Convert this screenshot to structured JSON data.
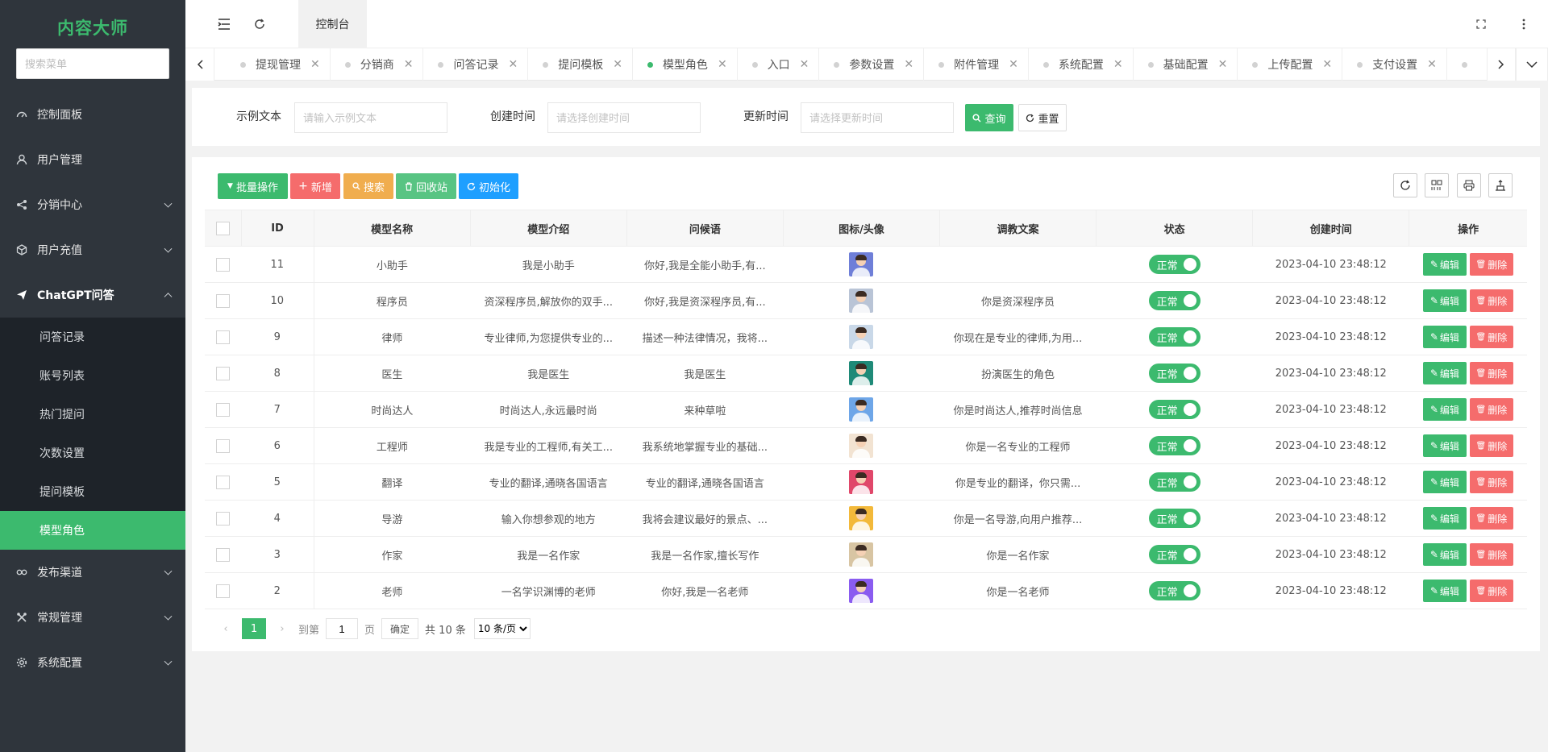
{
  "app": {
    "title": "内容大师",
    "search_placeholder": "搜索菜单"
  },
  "menu": [
    {
      "label": "控制面板",
      "icon": "dashboard-icon"
    },
    {
      "label": "用户管理",
      "icon": "user-icon"
    },
    {
      "label": "分销中心",
      "icon": "share-icon"
    },
    {
      "label": "用户充值",
      "icon": "box-icon"
    },
    {
      "label": "ChatGPT问答",
      "icon": "send-icon"
    }
  ],
  "submenu": [
    "问答记录",
    "账号列表",
    "热门提问",
    "次数设置",
    "提问模板",
    "模型角色"
  ],
  "menu_after": [
    {
      "label": "发布渠道",
      "icon": "link-icon"
    },
    {
      "label": "常规管理",
      "icon": "tools-icon"
    },
    {
      "label": "系统配置",
      "icon": "gear-icon"
    }
  ],
  "topbar": {
    "tab": "控制台"
  },
  "tabs": [
    "提现管理",
    "分销商",
    "问答记录",
    "提问模板",
    "模型角色",
    "入口",
    "参数设置",
    "附件管理",
    "系统配置",
    "基础配置",
    "上传配置",
    "支付设置",
    ""
  ],
  "active_tab": "模型角色",
  "filter": {
    "f1_label": "示例文本",
    "f1_placeholder": "请输入示例文本",
    "f2_label": "创建时间",
    "f2_placeholder": "请选择创建时间",
    "f3_label": "更新时间",
    "f3_placeholder": "请选择更新时间",
    "query": "查询",
    "reset": "重置"
  },
  "toolbar": {
    "batch": "批量操作",
    "add": "新增",
    "search": "搜索",
    "recycle": "回收站",
    "init": "初始化"
  },
  "columns": [
    "ID",
    "模型名称",
    "模型介绍",
    "问候语",
    "图标/头像",
    "调教文案",
    "状态",
    "创建时间",
    "操作"
  ],
  "rows": [
    {
      "id": "11",
      "name": "小助手",
      "intro": "我是小助手",
      "greet": "你好,我是全能小助手,有...",
      "prompt": "",
      "status": "正常",
      "time": "2023-04-10 23:48:12",
      "avatar": "#6f7fd8"
    },
    {
      "id": "10",
      "name": "程序员",
      "intro": "资深程序员,解放你的双手...",
      "greet": "你好,我是资深程序员,有...",
      "prompt": "你是资深程序员",
      "status": "正常",
      "time": "2023-04-10 23:48:12",
      "avatar": "#b9c4d6"
    },
    {
      "id": "9",
      "name": "律师",
      "intro": "专业律师,为您提供专业的...",
      "greet": "描述一种法律情况，我将...",
      "prompt": "你现在是专业的律师,为用...",
      "status": "正常",
      "time": "2023-04-10 23:48:12",
      "avatar": "#c9d8e8"
    },
    {
      "id": "8",
      "name": "医生",
      "intro": "我是医生",
      "greet": "我是医生",
      "prompt": "扮演医生的角色",
      "status": "正常",
      "time": "2023-04-10 23:48:12",
      "avatar": "#1f8a78"
    },
    {
      "id": "7",
      "name": "时尚达人",
      "intro": "时尚达人,永远最时尚",
      "greet": "来种草啦",
      "prompt": "你是时尚达人,推荐时尚信息",
      "status": "正常",
      "time": "2023-04-10 23:48:12",
      "avatar": "#6ea6e8"
    },
    {
      "id": "6",
      "name": "工程师",
      "intro": "我是专业的工程师,有关工...",
      "greet": "我系统地掌握专业的基础...",
      "prompt": "你是一名专业的工程师",
      "status": "正常",
      "time": "2023-04-10 23:48:12",
      "avatar": "#f2e3d2"
    },
    {
      "id": "5",
      "name": "翻译",
      "intro": "专业的翻译,通晓各国语言",
      "greet": "专业的翻译,通晓各国语言",
      "prompt": "你是专业的翻译，你只需...",
      "status": "正常",
      "time": "2023-04-10 23:48:12",
      "avatar": "#e0476a"
    },
    {
      "id": "4",
      "name": "导游",
      "intro": "输入你想参观的地方",
      "greet": "我将会建议最好的景点、...",
      "prompt": "你是一名导游,向用户推荐...",
      "status": "正常",
      "time": "2023-04-10 23:48:12",
      "avatar": "#f3b93a"
    },
    {
      "id": "3",
      "name": "作家",
      "intro": "我是一名作家",
      "greet": "我是一名作家,擅长写作",
      "prompt": "你是一名作家",
      "status": "正常",
      "time": "2023-04-10 23:48:12",
      "avatar": "#d8c5a3"
    },
    {
      "id": "2",
      "name": "老师",
      "intro": "一名学识渊博的老师",
      "greet": "你好,我是一名老师",
      "prompt": "你是一名老师",
      "status": "正常",
      "time": "2023-04-10 23:48:12",
      "avatar": "#8a5cf0"
    }
  ],
  "row_actions": {
    "edit": "编辑",
    "del": "删除"
  },
  "pager": {
    "page": "1",
    "goto": "到第",
    "goto_value": "1",
    "page_unit": "页",
    "ok": "确定",
    "total": "共 10 条",
    "size": "10 条/页"
  },
  "colors": {
    "brand": "#3cba6e",
    "danger": "#f56c6c",
    "warning": "#f0ad4e",
    "info": "#1e9fff",
    "sidebar": "#2f353c"
  }
}
